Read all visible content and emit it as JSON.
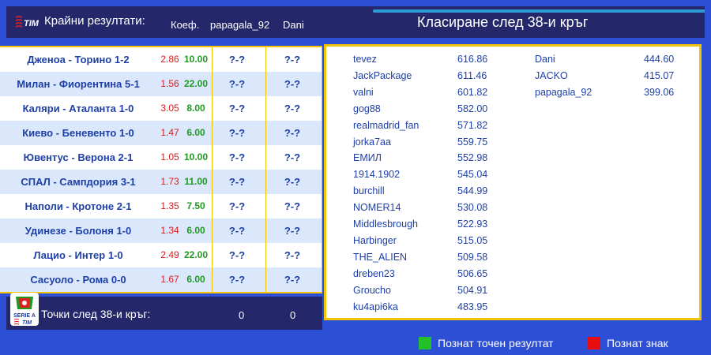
{
  "header": {
    "title": "Крайни резултати:",
    "col_odds": "Коеф.",
    "col_player1": "papagala_92",
    "col_player2": "Dani",
    "standings_title": "Класиране след 38-и кръг",
    "logo_text": "TIM"
  },
  "matches": [
    {
      "match": "Дженоа - Торино 1-2",
      "odd": "2.86",
      "points": "10.00",
      "p1": "?-?",
      "p2": "?-?"
    },
    {
      "match": "Милан - Фиорентина 5-1",
      "odd": "1.56",
      "points": "22.00",
      "p1": "?-?",
      "p2": "?-?"
    },
    {
      "match": "Каляри - Аталанта 1-0",
      "odd": "3.05",
      "points": "8.00",
      "p1": "?-?",
      "p2": "?-?"
    },
    {
      "match": "Киево - Беневенто 1-0",
      "odd": "1.47",
      "points": "6.00",
      "p1": "?-?",
      "p2": "?-?"
    },
    {
      "match": "Ювентус - Верона 2-1",
      "odd": "1.05",
      "points": "10.00",
      "p1": "?-?",
      "p2": "?-?"
    },
    {
      "match": "СПАЛ - Сампдория 3-1",
      "odd": "1.73",
      "points": "11.00",
      "p1": "?-?",
      "p2": "?-?"
    },
    {
      "match": "Наполи - Кротоне 2-1",
      "odd": "1.35",
      "points": "7.50",
      "p1": "?-?",
      "p2": "?-?"
    },
    {
      "match": "Удинезе - Болоня 1-0",
      "odd": "1.34",
      "points": "6.00",
      "p1": "?-?",
      "p2": "?-?"
    },
    {
      "match": "Лацио - Интер 1-0",
      "odd": "2.49",
      "points": "22.00",
      "p1": "?-?",
      "p2": "?-?"
    },
    {
      "match": "Сасуоло - Рома  0-0",
      "odd": "1.67",
      "points": "6.00",
      "p1": "?-?",
      "p2": "?-?"
    }
  ],
  "footer": {
    "label": "Точки след 38-и кръг:",
    "p1_points": "0",
    "p2_points": "0",
    "seriea_text": "SERIE A",
    "seriea_tim": "TIM"
  },
  "standings_col1": [
    {
      "name": "tevez",
      "points": "616.86"
    },
    {
      "name": "JackPackage",
      "points": "611.46"
    },
    {
      "name": "valni",
      "points": "601.82"
    },
    {
      "name": "gog88",
      "points": "582.00"
    },
    {
      "name": "realmadrid_fan",
      "points": "571.82"
    },
    {
      "name": "jorka7aa",
      "points": "559.75"
    },
    {
      "name": "ЕМИЛ",
      "points": "552.98"
    },
    {
      "name": "1914.1902",
      "points": "545.04"
    },
    {
      "name": "burchill",
      "points": "544.99"
    },
    {
      "name": "NOMER14",
      "points": "530.08"
    },
    {
      "name": "Middlesbrough",
      "points": "522.93"
    },
    {
      "name": "Harbinger",
      "points": "515.05"
    },
    {
      "name": "THE_ALIEN",
      "points": "509.58"
    },
    {
      "name": "dreben23",
      "points": "506.65"
    },
    {
      "name": "Groucho",
      "points": "504.91"
    },
    {
      "name": "ku4api6ka",
      "points": "483.95"
    }
  ],
  "standings_col2": [
    {
      "name": "Dani",
      "points": "444.60"
    },
    {
      "name": "JACKO",
      "points": "415.07"
    },
    {
      "name": "papagala_92",
      "points": "399.06"
    }
  ],
  "legend": {
    "exact": "Познат точен резултат",
    "exact_color": "#22c12a",
    "sign": "Познат знак",
    "sign_color": "#e80e0e"
  }
}
